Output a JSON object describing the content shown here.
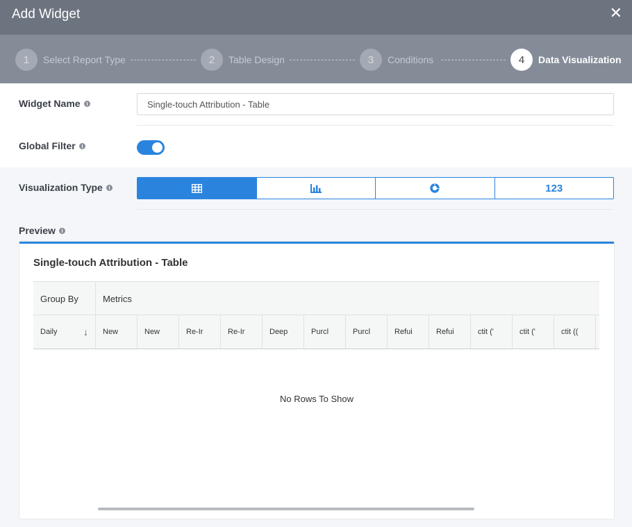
{
  "header": {
    "title": "Add Widget",
    "close_glyph": "✕"
  },
  "steps": [
    {
      "num": "1",
      "label": "Select Report Type",
      "state": "done"
    },
    {
      "num": "2",
      "label": "Table Design",
      "state": "done"
    },
    {
      "num": "3",
      "label": "Conditions",
      "state": "done"
    },
    {
      "num": "4",
      "label": "Data Visualization",
      "state": "active"
    }
  ],
  "form": {
    "widget_name_label": "Widget Name",
    "widget_name_value": "Single-touch Attribution - Table",
    "global_filter_label": "Global Filter",
    "global_filter_on": true,
    "viz_type_label": "Visualization Type",
    "viz_options": [
      {
        "icon": "table-icon",
        "label": "",
        "active": true
      },
      {
        "icon": "bar-chart-icon",
        "label": "",
        "active": false
      },
      {
        "icon": "donut-chart-icon",
        "label": "",
        "active": false
      },
      {
        "icon": "",
        "label": "123",
        "active": false
      }
    ],
    "preview_label": "Preview"
  },
  "preview": {
    "title": "Single-touch Attribution - Table",
    "group_header_1": "Group By",
    "group_header_2": "Metrics",
    "columns": [
      "Daily",
      "New",
      "New",
      "Re-Ir",
      "Re-Ir",
      "Deep",
      "Purcl",
      "Purcl",
      "Refui",
      "Refui",
      "ctit ('",
      "ctit ('",
      "ctit (("
    ],
    "sort_glyph": "↓",
    "empty_message": "No Rows To Show"
  },
  "colors": {
    "accent": "#2a84de",
    "title_bar": "#6c7480",
    "steps_bar": "#848c98"
  }
}
